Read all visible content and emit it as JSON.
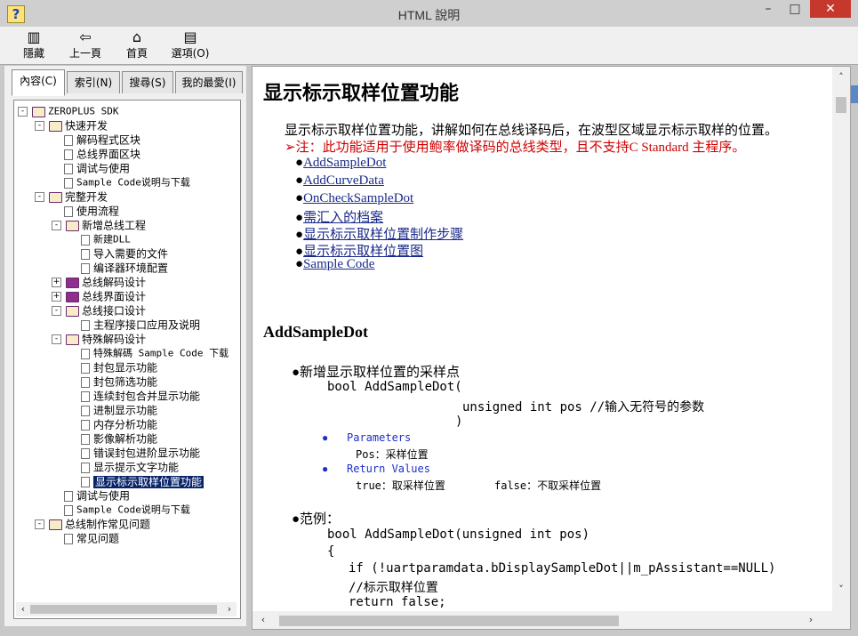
{
  "window": {
    "title": "HTML 說明",
    "icon": "help-book-icon",
    "minimize": "–",
    "maximize": "□",
    "close": "✕"
  },
  "toolbar": {
    "hide_label": "隱藏",
    "back_label": "上一頁",
    "home_label": "首頁",
    "options_label": "選項(O)",
    "hide_icon": "hide-pane-icon",
    "back_icon": "back-arrow-icon",
    "home_icon": "home-icon",
    "options_icon": "options-icon"
  },
  "tabs": [
    "內容(C)",
    "索引(N)",
    "搜尋(S)",
    "我的最愛(I)"
  ],
  "tree": [
    {
      "label": "ZEROPLUS SDK",
      "level": 0,
      "kind": "book-open",
      "exp": "-"
    },
    {
      "label": "快速开发",
      "level": 1,
      "kind": "book-open",
      "exp": "-"
    },
    {
      "label": "解码程式区块",
      "level": 2,
      "kind": "page"
    },
    {
      "label": "总线界面区块",
      "level": 2,
      "kind": "page"
    },
    {
      "label": "调试与使用",
      "level": 2,
      "kind": "page"
    },
    {
      "label": "Sample Code说明与下载",
      "level": 2,
      "kind": "page"
    },
    {
      "label": "完整开发",
      "level": 1,
      "kind": "book-open",
      "exp": "-"
    },
    {
      "label": "使用流程",
      "level": 2,
      "kind": "page"
    },
    {
      "label": "新增总线工程",
      "level": 2,
      "kind": "book-open",
      "exp": "-"
    },
    {
      "label": "新建DLL",
      "level": 3,
      "kind": "page"
    },
    {
      "label": "导入需要的文件",
      "level": 3,
      "kind": "page"
    },
    {
      "label": "编译器环境配置",
      "level": 3,
      "kind": "page"
    },
    {
      "label": "总线解码设计",
      "level": 2,
      "kind": "book-closed",
      "exp": "+"
    },
    {
      "label": "总线界面设计",
      "level": 2,
      "kind": "book-closed",
      "exp": "+"
    },
    {
      "label": "总线接口设计",
      "level": 2,
      "kind": "book-open",
      "exp": "-"
    },
    {
      "label": "主程序接口应用及说明",
      "level": 3,
      "kind": "page"
    },
    {
      "label": "特殊解码设计",
      "level": 2,
      "kind": "book-open",
      "exp": "-"
    },
    {
      "label": "特殊解碼 Sample Code 下载",
      "level": 3,
      "kind": "page"
    },
    {
      "label": "封包显示功能",
      "level": 3,
      "kind": "page"
    },
    {
      "label": "封包筛选功能",
      "level": 3,
      "kind": "page"
    },
    {
      "label": "连续封包合并显示功能",
      "level": 3,
      "kind": "page"
    },
    {
      "label": "进制显示功能",
      "level": 3,
      "kind": "page"
    },
    {
      "label": "内存分析功能",
      "level": 3,
      "kind": "page"
    },
    {
      "label": "影像解析功能",
      "level": 3,
      "kind": "page"
    },
    {
      "label": "错误封包进阶显示功能",
      "level": 3,
      "kind": "page"
    },
    {
      "label": "显示提示文字功能",
      "level": 3,
      "kind": "page"
    },
    {
      "label": "显示标示取样位置功能",
      "level": 3,
      "kind": "page",
      "selected": true
    },
    {
      "label": "调试与使用",
      "level": 2,
      "kind": "page"
    },
    {
      "label": "Sample Code说明与下载",
      "level": 2,
      "kind": "page"
    },
    {
      "label": "总线制作常见问题",
      "level": 1,
      "kind": "book-open",
      "exp": "-"
    },
    {
      "label": "常见问题",
      "level": 2,
      "kind": "page"
    }
  ],
  "content": {
    "title": "显示标示取样位置功能",
    "intro": "显示标示取样位置功能，讲解如何在总线译码后，在波型区域显示标示取样的位置。",
    "note": "➢注：此功能适用于使用鲍率做译码的总线类型，且不支持C Standard 主程序。",
    "links": [
      "AddSampleDot",
      "AddCurveData",
      "OnCheckSampleDot",
      "需汇入的档案",
      "显示标示取样位置制作步骤",
      "显示标示取样位置图",
      "Sample Code"
    ],
    "section_title": "AddSampleDot",
    "bullet1": "●新增显示取样位置的采样点",
    "sig1": "bool AddSampleDot(",
    "sig2": "unsigned int pos //输入无符号的参数",
    "sig3": ")",
    "params_label": "Parameters",
    "param_desc": "Pos：采样位置",
    "return_label": "Return Values",
    "ret_true": "true：取采样位置",
    "ret_false": "false：不取采样位置",
    "bullet2": "●范例：",
    "code": [
      "bool    AddSampleDot(unsigned int pos)",
      "{",
      "if (!uartparamdata.bDisplaySampleDot||m_pAssistant==NULL)",
      "//标示取样位置",
      "return false;"
    ]
  }
}
